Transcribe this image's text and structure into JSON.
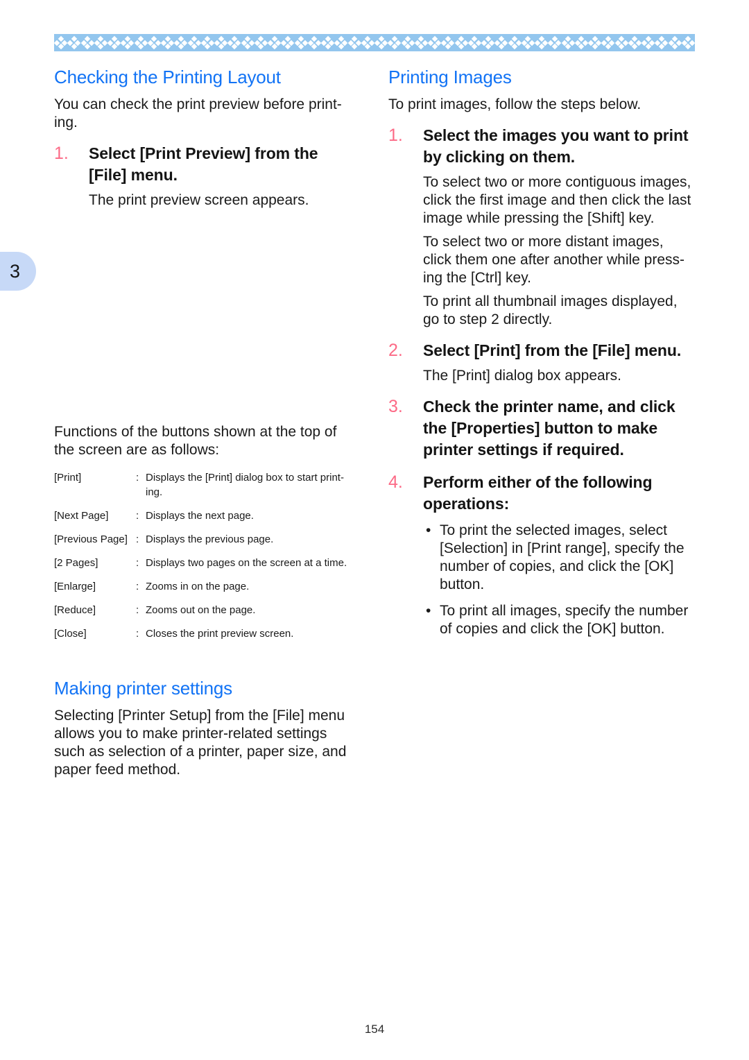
{
  "page": {
    "number": "154",
    "chapter_tab": "3",
    "accent_blue": "#1273f5",
    "accent_pink": "#fc6a86",
    "band_blue": "#93c6ee",
    "tab_blue": "#c7d9f7"
  },
  "ornament": {
    "motif_name": "four-diamond-clover",
    "count": 48
  },
  "left_column": {
    "heading": "Checking the Printing Layout",
    "intro": "You can check the print preview before print-ing.",
    "step": {
      "number": "1.",
      "title": "Select [Print Preview] from the [File] menu.",
      "body": "The print preview screen appears."
    },
    "table_intro": "Functions of the buttons shown at the top of the screen are as follows:",
    "table": {
      "colon": ":",
      "rows": [
        {
          "label": "[Print]",
          "desc": "Displays the [Print] dialog box to start print-ing."
        },
        {
          "label": "[Next Page]",
          "desc": "Displays the next page."
        },
        {
          "label": "[Previous Page]",
          "desc": "Displays the previous page."
        },
        {
          "label": "[2 Pages]",
          "desc": "Displays two pages on the screen at a time."
        },
        {
          "label": "[Enlarge]",
          "desc": "Zooms in on the page."
        },
        {
          "label": "[Reduce]",
          "desc": "Zooms out on the page."
        },
        {
          "label": "[Close]",
          "desc": "Closes the print preview screen."
        }
      ]
    },
    "heading2": "Making printer settings",
    "para2": "Selecting [Printer Setup] from the [File] menu allows you to make printer-related settings such as selection of a printer, paper size, and paper feed method."
  },
  "right_column": {
    "heading": "Printing Images",
    "intro": "To print images, follow the steps below.",
    "steps": [
      {
        "number": "1.",
        "title": "Select the images you want to print by clicking on them.",
        "paragraphs": [
          "To select two or more contiguous images, click the first image and then click the last image while pressing the [Shift] key.",
          "To select two or more distant images, click them one after another while press-ing the [Ctrl] key.",
          "To print all thumbnail images displayed, go to step 2 directly."
        ]
      },
      {
        "number": "2.",
        "title": "Select [Print] from the [File] menu.",
        "paragraphs": [
          "The [Print] dialog box appears."
        ]
      },
      {
        "number": "3.",
        "title": "Check the printer name, and click the [Properties] button to make printer settings if required.",
        "paragraphs": []
      },
      {
        "number": "4.",
        "title": "Perform either of the following operations:",
        "paragraphs": []
      }
    ],
    "bullet_marker": "•",
    "bullets": [
      "To print the selected images, select [Selection] in [Print range], specify the number of copies, and click the [OK] button.",
      "To print all images, specify the number of copies and click the [OK] button."
    ]
  }
}
